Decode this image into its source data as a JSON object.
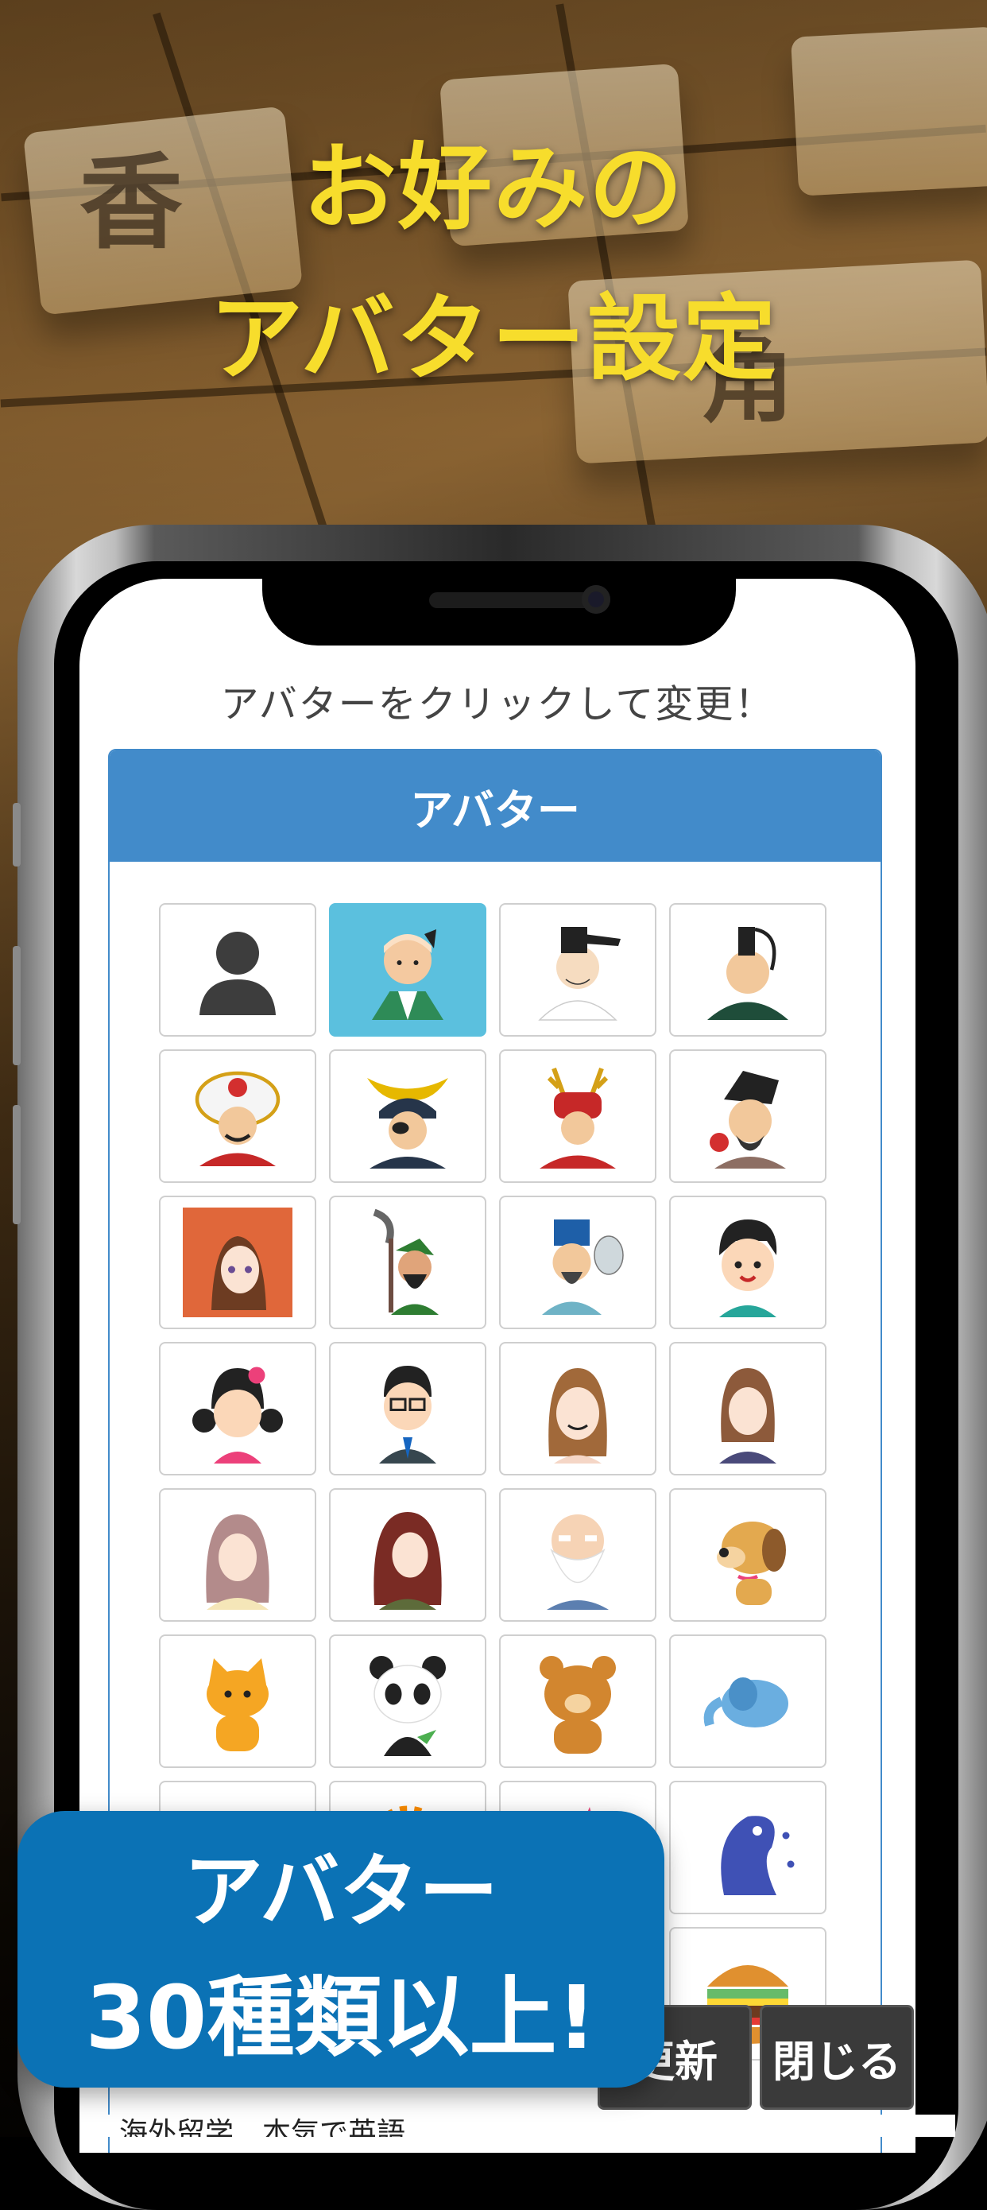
{
  "headline": {
    "line1": "お好みの",
    "line2": "アバター設定"
  },
  "screen": {
    "instruction": "アバターをクリックして変更！",
    "panel_title": "アバター",
    "selected_index": 1,
    "avatars": [
      "default-silhouette-icon",
      "nobunaga-icon",
      "court-noble-icon",
      "tokugawa-icon",
      "lion-helmet-samurai-icon",
      "date-masamune-icon",
      "red-armor-samurai-icon",
      "prince-shotoku-icon",
      "anime-girl-red-icon",
      "guan-yu-icon",
      "zhuge-liang-icon",
      "boy-icon",
      "girl-flower-icon",
      "glasses-man-icon",
      "woman-brown-hair-icon",
      "anime-office-lady-icon",
      "anime-girl-pink-icon",
      "anime-girl-redhead-icon",
      "old-sage-icon",
      "dog-icon",
      "cat-icon",
      "panda-icon",
      "bear-icon",
      "elephant-icon",
      "green-monster-icon",
      "sun-icon",
      "blue-bird-icon",
      "blue-dragon-icon",
      "hamburger-icon"
    ],
    "buttons": {
      "update": "更新",
      "close": "閉じる"
    },
    "ticker": "海外留学　本気で英語"
  },
  "banner": {
    "line1": "アバター",
    "line2": "30種類以上!"
  },
  "colors": {
    "headline": "#f7dd2c",
    "panel": "#428bca",
    "selected": "#5bc0de",
    "banner": "#0b72b5"
  }
}
